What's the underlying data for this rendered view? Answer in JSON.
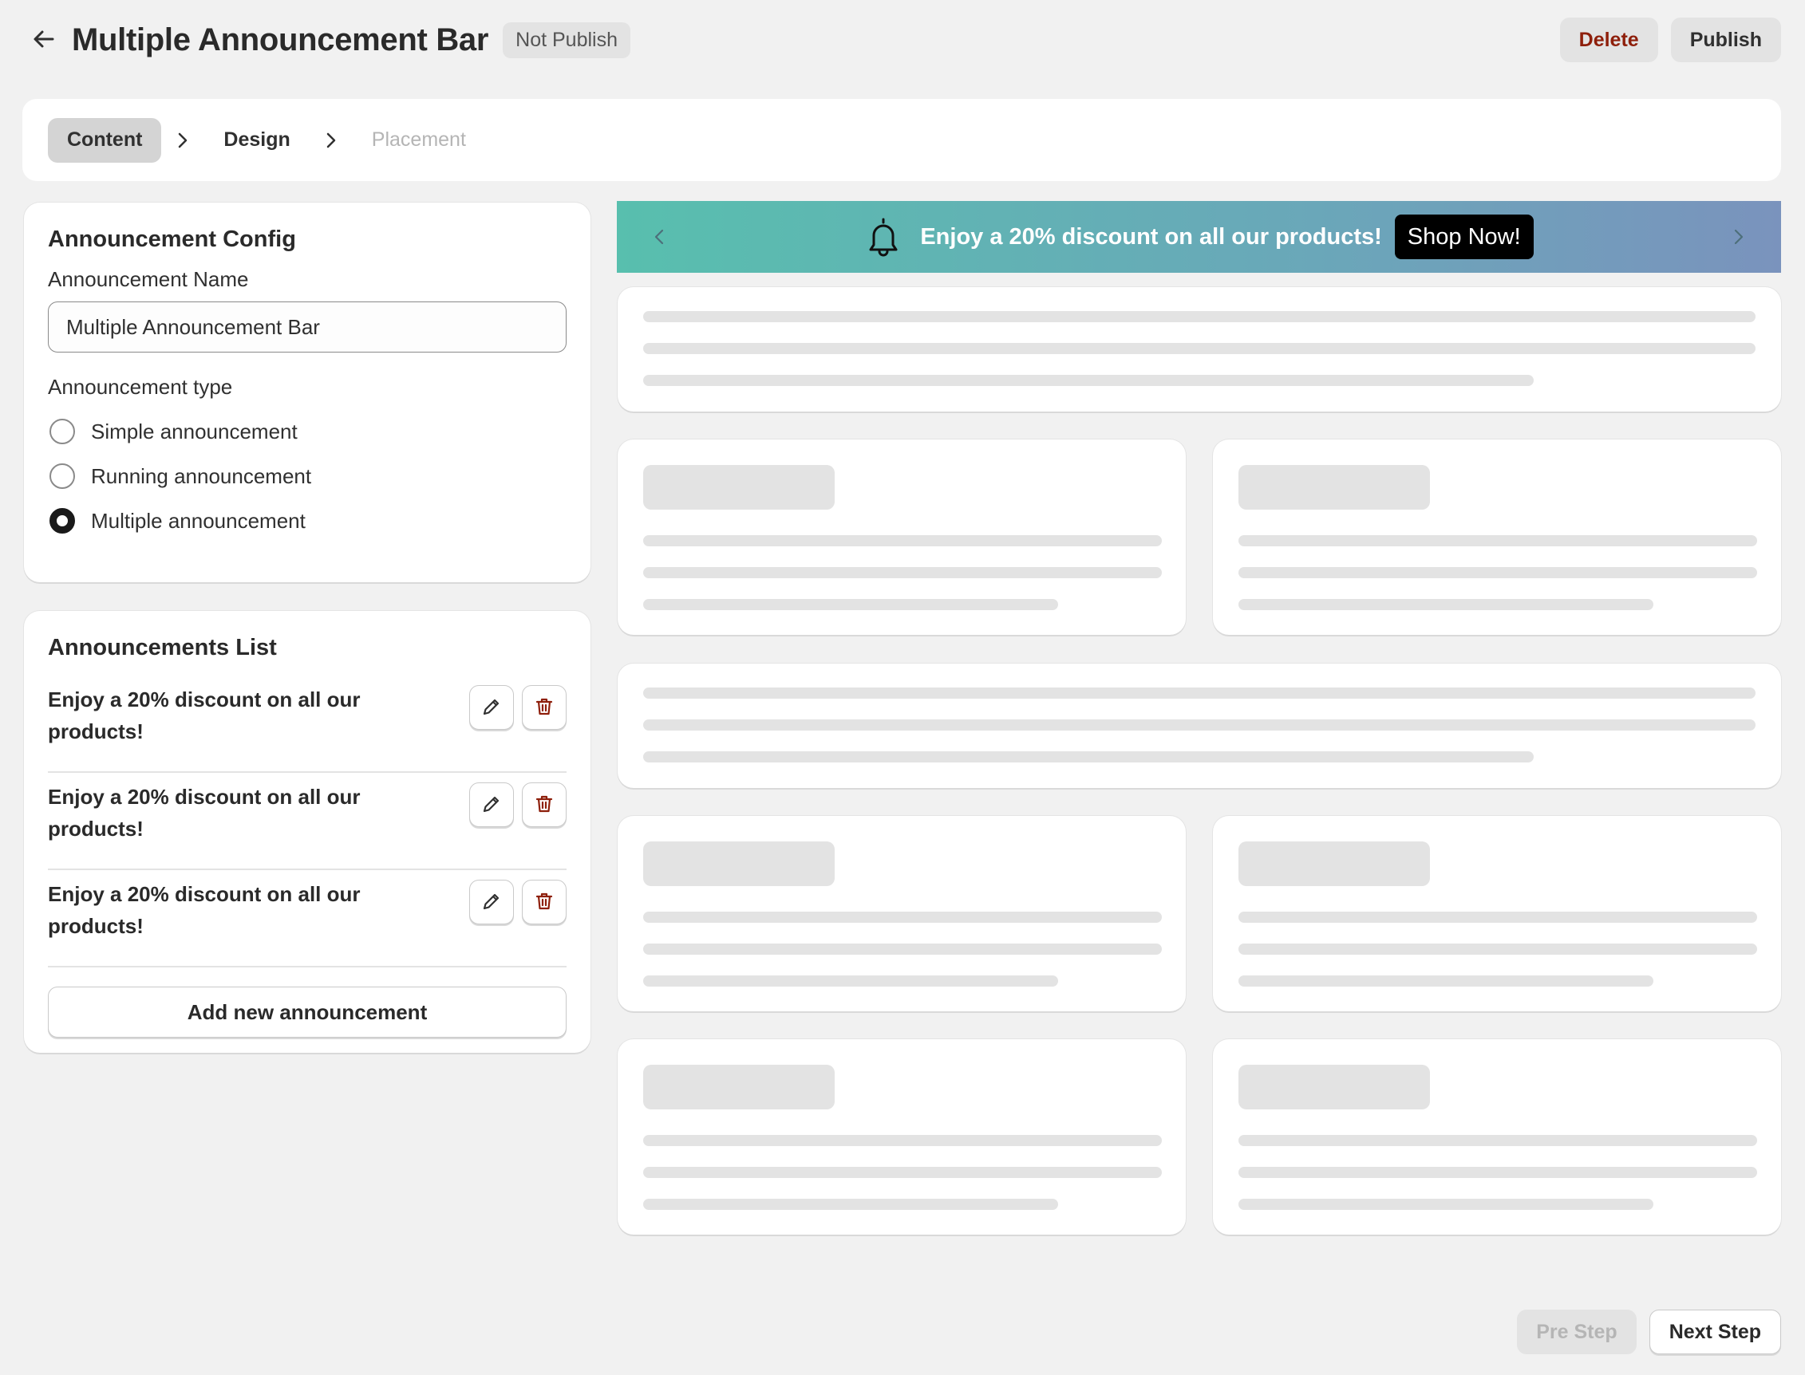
{
  "header": {
    "title": "Multiple Announcement Bar",
    "status": "Not Publish",
    "delete_label": "Delete",
    "publish_label": "Publish"
  },
  "steps": [
    {
      "label": "Content",
      "state": "active"
    },
    {
      "label": "Design",
      "state": "enabled"
    },
    {
      "label": "Placement",
      "state": "disabled"
    }
  ],
  "config": {
    "title": "Announcement Config",
    "name_label": "Announcement Name",
    "name_value": "Multiple Announcement Bar",
    "type_label": "Announcement type",
    "types": [
      {
        "label": "Simple announcement",
        "checked": false
      },
      {
        "label": "Running announcement",
        "checked": false
      },
      {
        "label": "Multiple announcement",
        "checked": true
      }
    ]
  },
  "list": {
    "title": "Announcements List",
    "items": [
      {
        "text": "Enjoy a 20% discount on all our products!"
      },
      {
        "text": "Enjoy a 20% discount on all our products!"
      },
      {
        "text": "Enjoy a 20% discount on all our products!"
      }
    ],
    "add_label": "Add new announcement"
  },
  "preview": {
    "bar_text": "Enjoy a 20% discount on all our products!",
    "bar_button": "Shop Now!",
    "gradient_start": "#58bfae",
    "gradient_end": "#7a93bd"
  },
  "footer": {
    "pre_label": "Pre Step",
    "next_label": "Next Step"
  },
  "icons": {
    "back": "arrow-left-icon",
    "chevron": "chevron-right-icon",
    "bell": "bell-icon",
    "edit": "pencil-icon",
    "delete": "trash-icon"
  },
  "colors": {
    "background": "#f1f1f1",
    "danger": "#8e1f0b",
    "active_step": "#d4d4d4"
  }
}
